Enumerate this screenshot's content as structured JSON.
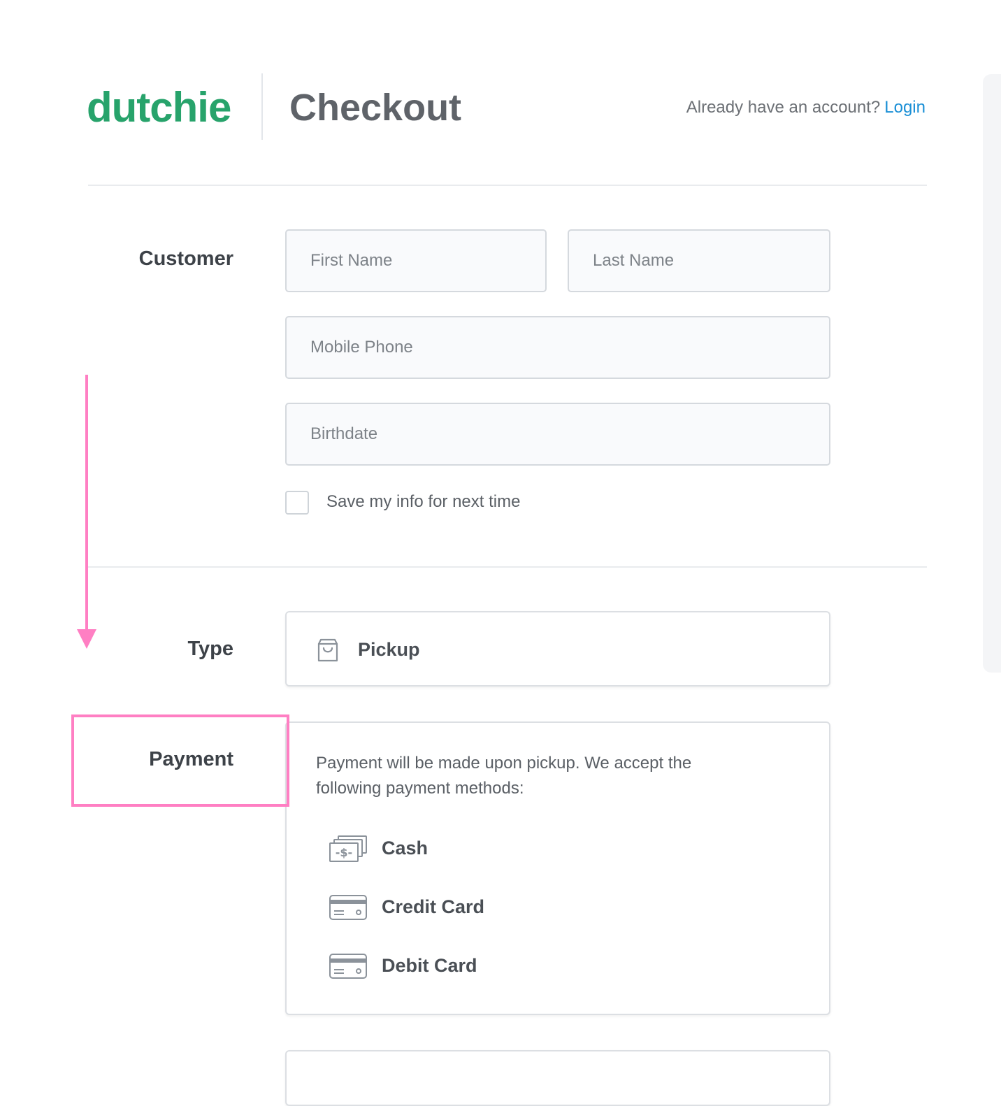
{
  "colors": {
    "brand_green": "#27a36b",
    "link_blue": "#1a8fd6",
    "annotation_pink": "#ff7fc3"
  },
  "header": {
    "logo_text": "dutchie",
    "title": "Checkout",
    "account_prompt": "Already have an account?",
    "login_label": "Login"
  },
  "customer": {
    "section_label": "Customer",
    "first_name_placeholder": "First Name",
    "last_name_placeholder": "Last Name",
    "mobile_phone_placeholder": "Mobile Phone",
    "birthdate_placeholder": "Birthdate",
    "save_info_label": "Save my info for next time",
    "save_info_checked": false
  },
  "order_type": {
    "section_label": "Type",
    "selected_icon": "shopping-bag-icon",
    "selected_label": "Pickup"
  },
  "payment": {
    "section_label": "Payment",
    "description": "Payment will be made upon pickup. We accept the following payment methods:",
    "methods": [
      {
        "icon": "cash-icon",
        "label": "Cash"
      },
      {
        "icon": "credit-card-icon",
        "label": "Credit Card"
      },
      {
        "icon": "debit-card-icon",
        "label": "Debit Card"
      }
    ]
  }
}
